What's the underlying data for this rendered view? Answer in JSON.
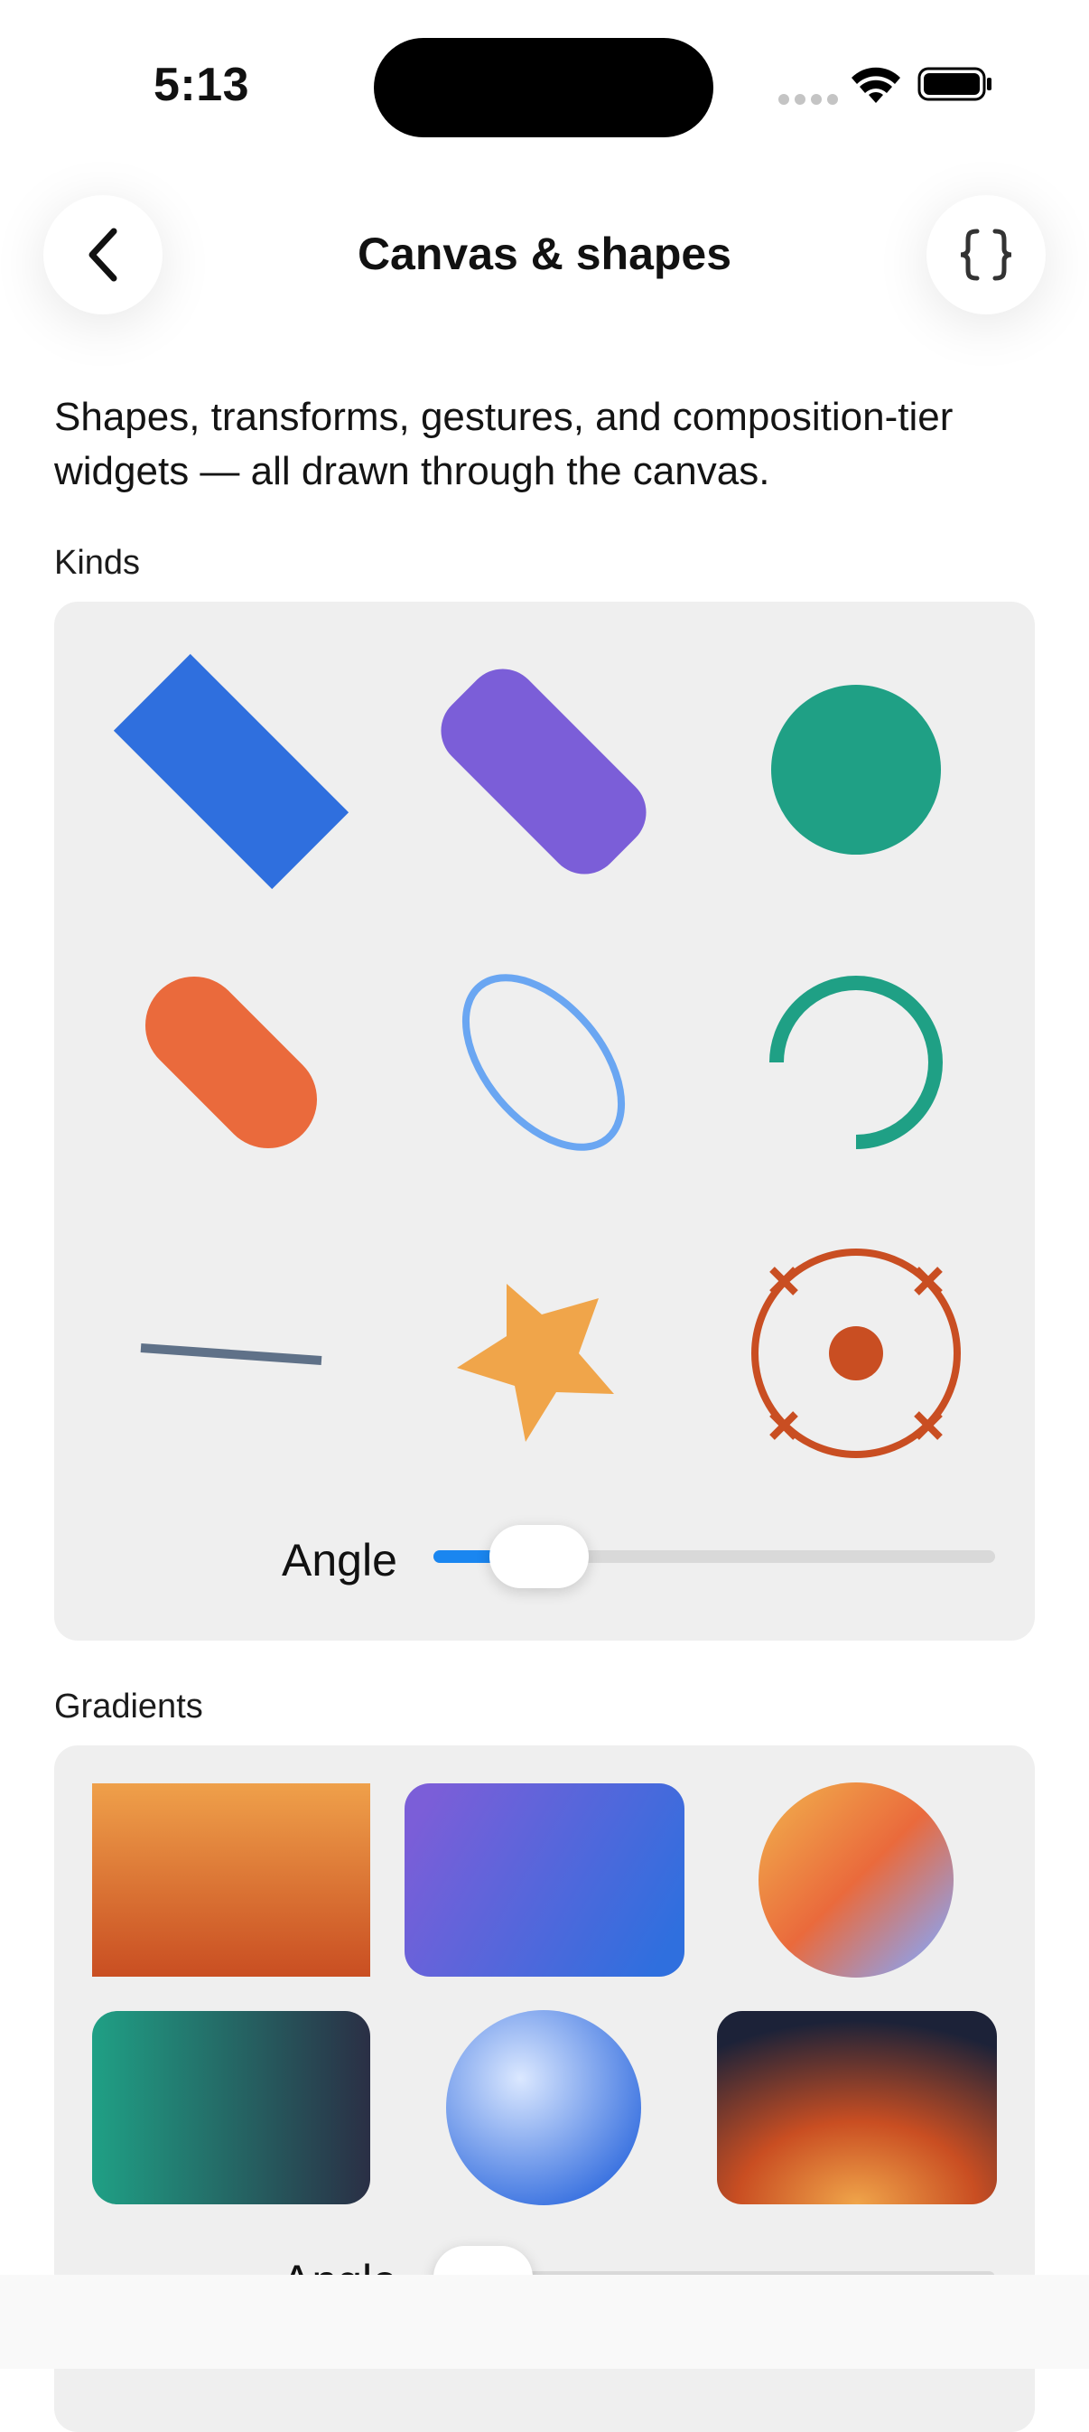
{
  "status": {
    "time": "5:13"
  },
  "nav": {
    "title": "Canvas & shapes",
    "back_icon": "chevron-left-icon",
    "code_icon": "braces-icon"
  },
  "intro": "Shapes, transforms, gestures, and composition-tier widgets — all drawn through the canvas.",
  "kinds": {
    "label": "Kinds",
    "shapes": [
      {
        "name": "rectangle",
        "color": "#2f6fde"
      },
      {
        "name": "rounded-rectangle",
        "color": "#7b5ed8"
      },
      {
        "name": "circle",
        "color": "#1fa085"
      },
      {
        "name": "capsule",
        "color": "#ea6a3c"
      },
      {
        "name": "ellipse-outline",
        "color": "#6aa6f2"
      },
      {
        "name": "arc",
        "color": "#1fa085"
      },
      {
        "name": "line",
        "color": "#5f7188"
      },
      {
        "name": "star",
        "color": "#f0a54a"
      },
      {
        "name": "target",
        "color": "#c94e22"
      }
    ],
    "angle_label": "Angle",
    "angle_value": 0.1
  },
  "gradients": {
    "label": "Gradients",
    "items": [
      {
        "name": "linear-vertical",
        "colors": [
          "#efa04a",
          "#c94e22"
        ]
      },
      {
        "name": "linear-diagonal",
        "colors": [
          "#7b5ed8",
          "#2f6fde"
        ]
      },
      {
        "name": "circle-linear",
        "colors": [
          "#f0a54a",
          "#ea6a3c",
          "#8fa0e8"
        ]
      },
      {
        "name": "linear-horizontal",
        "colors": [
          "#1fa085",
          "#2a2f45"
        ]
      },
      {
        "name": "radial-sphere",
        "colors": [
          "#dbe8ff",
          "#3a72e0"
        ]
      },
      {
        "name": "radial-glow",
        "colors": [
          "#f0a54a",
          "#c94e22",
          "#1c2238"
        ]
      }
    ],
    "angle_label": "Angle",
    "angle_value": 0.0
  }
}
